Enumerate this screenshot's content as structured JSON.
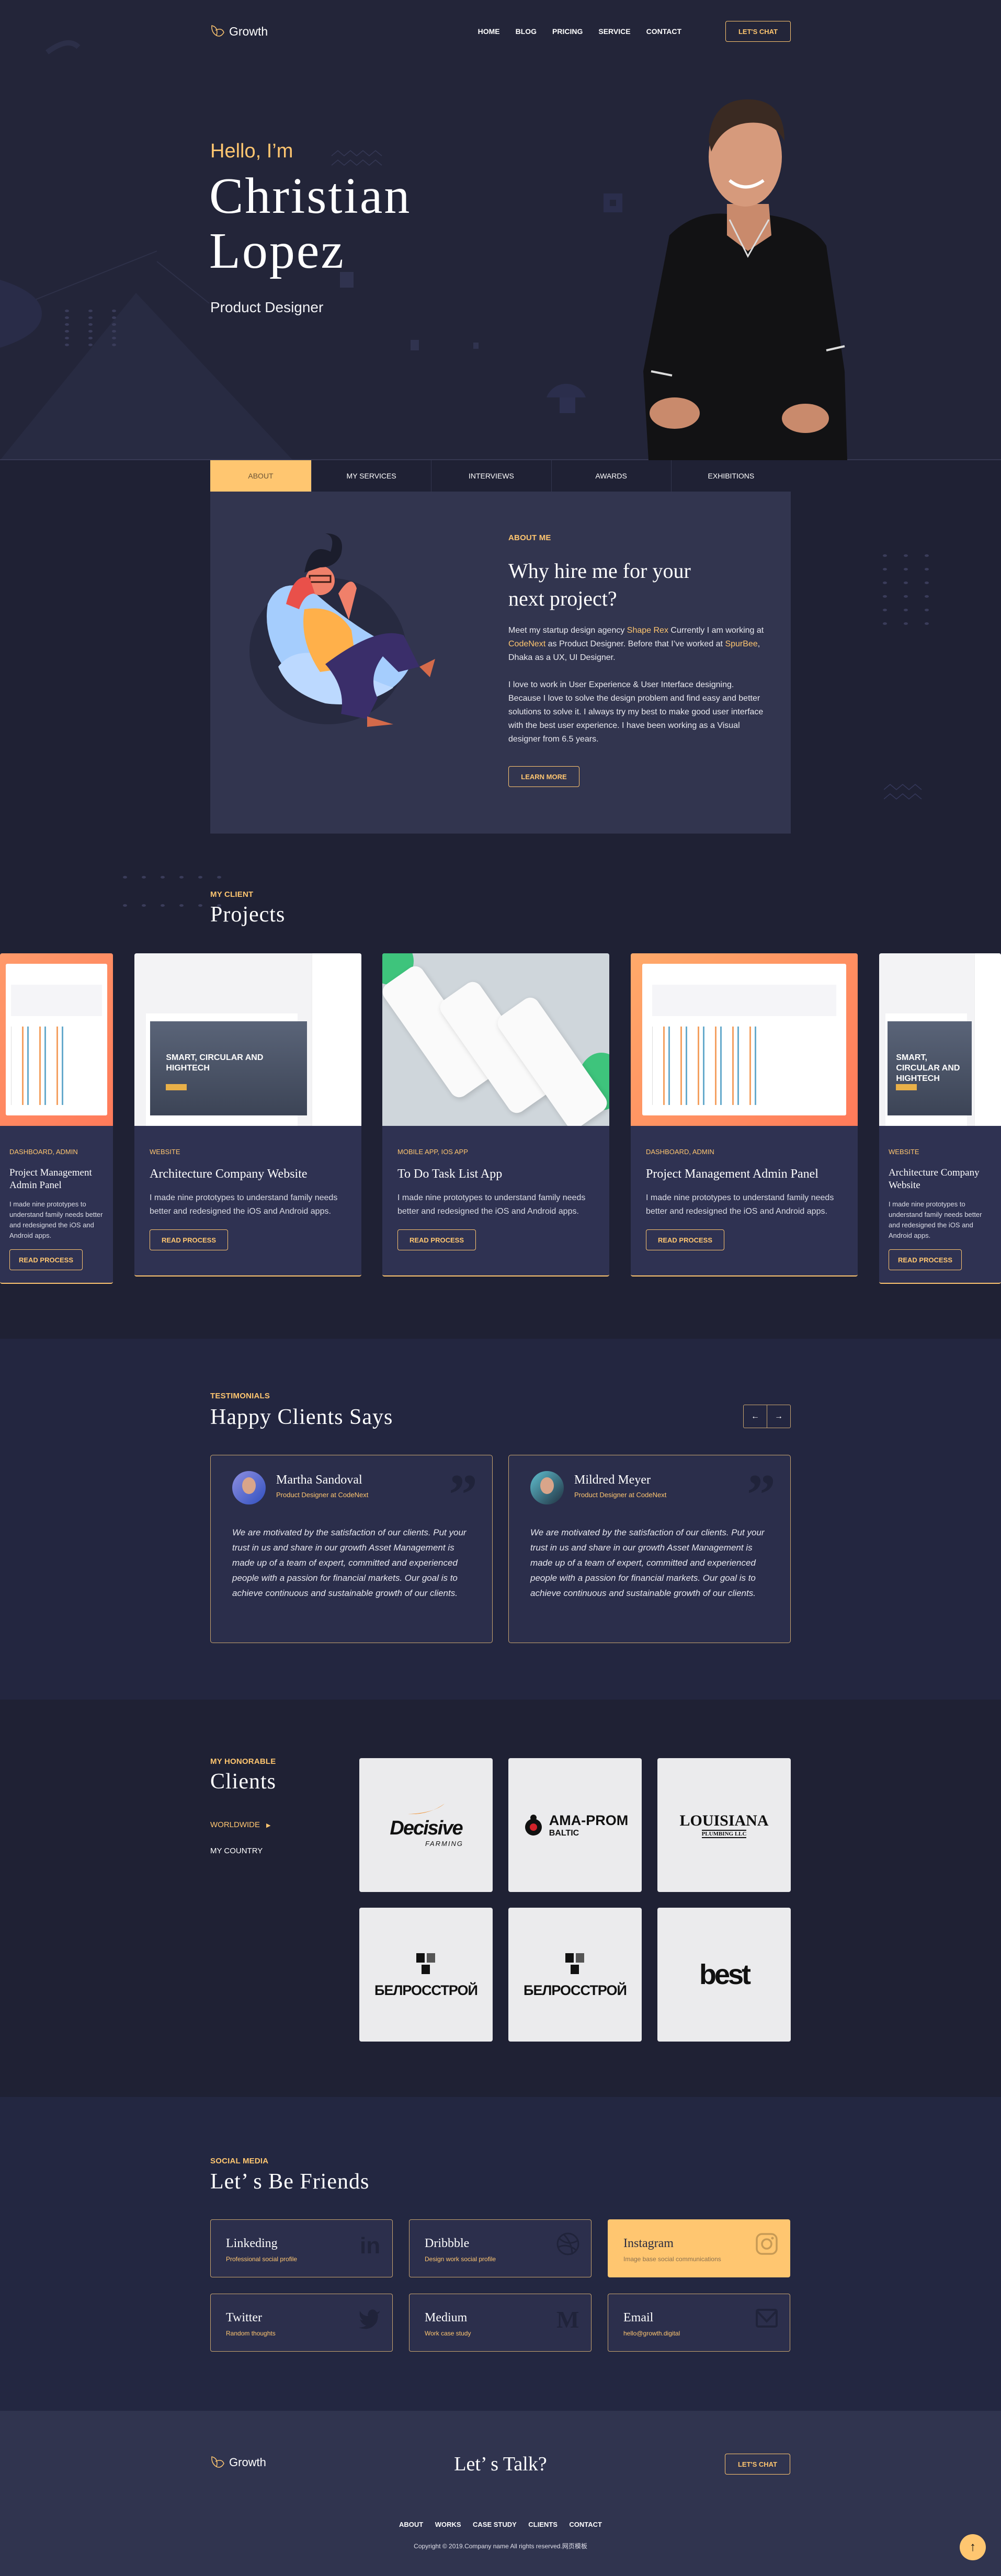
{
  "colors": {
    "accent": "#ffc670",
    "background": "#1f2134",
    "hero_bg": "#232539",
    "panel": "#32354f",
    "footer": "#30344f"
  },
  "nav": {
    "brand": "Growth",
    "brand_icon": "leaf-icon",
    "links": [
      "HOME",
      "BLOG",
      "PRICING",
      "SERVICE",
      "CONTACT"
    ],
    "cta": "LET'S CHAT"
  },
  "hero": {
    "greeting": "Hello, I’m",
    "first_name": "Christian",
    "last_name": "Lopez",
    "role": "Product Designer"
  },
  "tabs": [
    {
      "label": "ABOUT",
      "active": true
    },
    {
      "label": "MY SERVICES"
    },
    {
      "label": "INTERVIEWS"
    },
    {
      "label": "AWARDS"
    },
    {
      "label": "EXHIBITIONS"
    }
  ],
  "about": {
    "eyebrow": "ABOUT ME",
    "heading_1": "Why hire me for your",
    "heading_2": "next project?",
    "p1": {
      "a": "Meet my startup design agency ",
      "link1": "Shape Rex",
      "b": " Currently I am working at ",
      "link2": "CodeNext",
      "c": " as Product Designer. Before that I’ve worked at ",
      "link3": "SpurBee",
      "d": ", Dhaka as a UX, UI Designer."
    },
    "p2": "I love to work in User Experience & User Interface designing. Because I love to solve the design problem and find easy and better solutions to solve it. I always try my best to make good user interface with the best user experience. I have been working as a Visual designer from 6.5 years.",
    "button": "LEARN MORE"
  },
  "projects": {
    "eyebrow": "MY CLIENT",
    "heading": "Projects",
    "items": [
      {
        "category": "DASHBOARD, ADMIN",
        "title": "Project Management Admin Panel",
        "desc": "I made nine prototypes to understand family needs better and redesigned the iOS and Android apps.",
        "button": "READ PROCESS"
      },
      {
        "category": "WEBSITE",
        "title": "Architecture Company Website",
        "desc": "I made nine prototypes to understand family needs better and redesigned the iOS and Android apps.",
        "button": "READ PROCESS",
        "img_text": "SMART, CIRCULAR AND HIGHTECH"
      },
      {
        "category": "MOBILE APP, IOS APP",
        "title": "To Do Task List App",
        "desc": "I made nine prototypes to understand family needs better and redesigned the iOS and Android apps.",
        "button": "READ PROCESS"
      },
      {
        "category": "DASHBOARD, ADMIN",
        "title": "Project Management Admin Panel",
        "desc": "I made nine prototypes to understand family needs better and redesigned the iOS and Android apps.",
        "button": "READ PROCESS"
      },
      {
        "category": "WEBSITE",
        "title": "Architecture Company Website",
        "desc": "I made nine prototypes to understand family needs better and redesigned the iOS and Android apps.",
        "button": "READ PROCESS",
        "img_text": "SMART, CIRCULAR AND HIGHTECH"
      }
    ]
  },
  "testimonials": {
    "eyebrow": "TESTIMONIALS",
    "heading": "Happy Clients Says",
    "prev": "←",
    "next": "→",
    "items": [
      {
        "name": "Martha Sandoval",
        "role": "Product Designer at CodeNext",
        "quote": "We are motivated by the satisfaction of our clients. Put your trust in us and share in our growth Asset Management is made up of a team of expert, committed and experienced people with a passion for financial markets. Our goal is to achieve continuous and sustainable growth of our clients."
      },
      {
        "name": "Mildred Meyer",
        "role": "Product Designer at CodeNext",
        "quote": "We are motivated by the satisfaction of our clients. Put your trust in us and share in our growth Asset Management is made up of a team of expert, committed and experienced people with a passion for financial markets. Our goal is to achieve continuous and sustainable growth of our clients."
      }
    ]
  },
  "clients": {
    "eyebrow": "MY HONORABLE",
    "heading": "Clients",
    "filters": [
      {
        "label": "WORLDWIDE",
        "active": true
      },
      {
        "label": "MY COUNTRY"
      }
    ],
    "logos": [
      {
        "name": "Decisive",
        "sub": "FARMING"
      },
      {
        "name": "AMA-PROM",
        "sub": "BALTIC"
      },
      {
        "name": "LOUISIANA",
        "sub": "PLUMBING LLC"
      },
      {
        "name": "БЕЛРОССТРОЙ"
      },
      {
        "name": "БЕЛРОССТРОЙ"
      },
      {
        "name": "best"
      }
    ]
  },
  "social": {
    "eyebrow": "SOCIAL MEDIA",
    "heading": "Let’ s Be Friends",
    "items": [
      {
        "title": "Linkeding",
        "sub": "Professional social profile",
        "icon": "linkedin-icon"
      },
      {
        "title": "Dribbble",
        "sub": "Design work social profile",
        "icon": "dribbble-icon"
      },
      {
        "title": "Instagram",
        "sub": "Image base social communications",
        "icon": "instagram-icon",
        "highlighted": true
      },
      {
        "title": "Twitter",
        "sub": "Random thoughts",
        "icon": "twitter-icon"
      },
      {
        "title": "Medium",
        "sub": "Work case study",
        "icon": "medium-icon"
      },
      {
        "title": "Email",
        "sub": "hello@growth.digital",
        "icon": "mail-icon"
      }
    ]
  },
  "footer": {
    "brand": "Growth",
    "heading": "Let’ s Talk?",
    "cta": "LET'S CHAT",
    "links": [
      "ABOUT",
      "WORKS",
      "CASE STUDY",
      "CLIENTS",
      "CONTACT"
    ],
    "copyright": "Copyright © 2019.Company name All rights reserved.网页模板",
    "scroll_top": "↑"
  }
}
